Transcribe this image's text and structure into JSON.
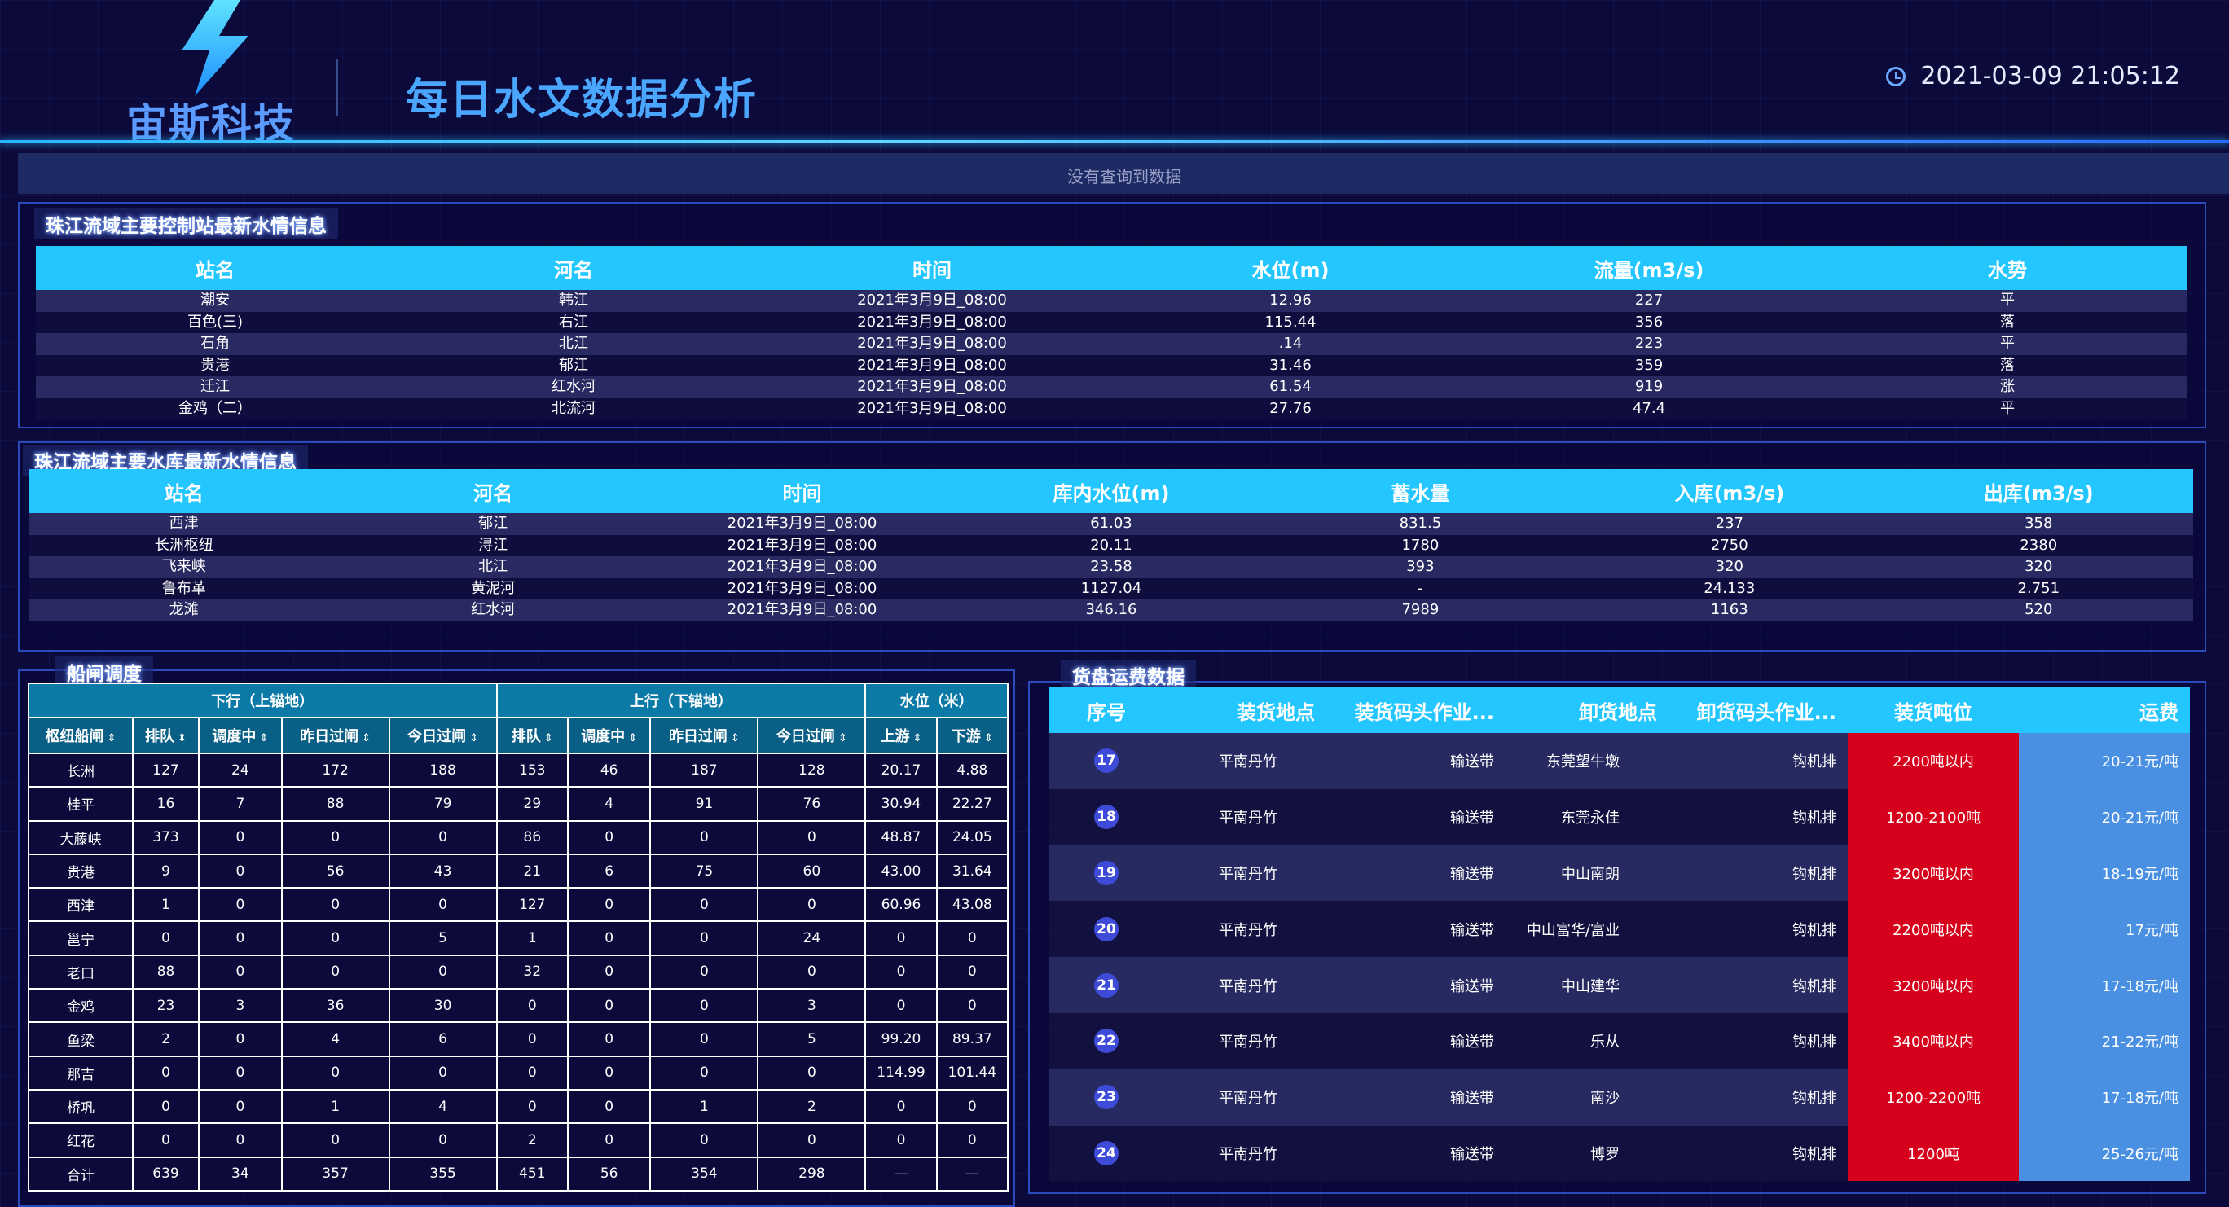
{
  "header": {
    "logo_text": "宙斯科技",
    "title": "每日水文数据分析",
    "datetime": "2021-03-09 21:05:12"
  },
  "notice": "没有查询到数据",
  "stations": {
    "label": "珠江流域主要控制站最新水情信息",
    "columns": [
      "站名",
      "河名",
      "时间",
      "水位(m)",
      "流量(m3/s)",
      "水势"
    ],
    "rows": [
      [
        "潮安",
        "韩江",
        "2021年3月9日_08:00",
        "12.96",
        "227",
        "平"
      ],
      [
        "百色(三)",
        "右江",
        "2021年3月9日_08:00",
        "115.44",
        "356",
        "落"
      ],
      [
        "石角",
        "北江",
        "2021年3月9日_08:00",
        ".14",
        "223",
        "平"
      ],
      [
        "贵港",
        "郁江",
        "2021年3月9日_08:00",
        "31.46",
        "359",
        "落"
      ],
      [
        "迁江",
        "红水河",
        "2021年3月9日_08:00",
        "61.54",
        "919",
        "涨"
      ],
      [
        "金鸡（二）",
        "北流河",
        "2021年3月9日_08:00",
        "27.76",
        "47.4",
        "平"
      ]
    ]
  },
  "reservoirs": {
    "label": "珠江流域主要水库最新水情信息",
    "columns": [
      "站名",
      "河名",
      "时间",
      "库内水位(m)",
      "蓄水量",
      "入库(m3/s)",
      "出库(m3/s)"
    ],
    "rows": [
      [
        "西津",
        "郁江",
        "2021年3月9日_08:00",
        "61.03",
        "831.5",
        "237",
        "358"
      ],
      [
        "长洲枢纽",
        "浔江",
        "2021年3月9日_08:00",
        "20.11",
        "1780",
        "2750",
        "2380"
      ],
      [
        "飞来峡",
        "北江",
        "2021年3月9日_08:00",
        "23.58",
        "393",
        "320",
        "320"
      ],
      [
        "鲁布革",
        "黄泥河",
        "2021年3月9日_08:00",
        "1127.04",
        "-",
        "24.133",
        "2.751"
      ],
      [
        "龙滩",
        "红水河",
        "2021年3月9日_08:00",
        "346.16",
        "7989",
        "1163",
        "520"
      ]
    ]
  },
  "locks": {
    "label": "船闸调度",
    "group_headers": [
      "下行（上锚地）",
      "上行（下锚地）",
      "水位（米）"
    ],
    "columns": [
      "枢纽船闸",
      "排队",
      "调度中",
      "昨日过闸",
      "今日过闸",
      "排队",
      "调度中",
      "昨日过闸",
      "今日过闸",
      "上游",
      "下游"
    ],
    "sort_icon": "⇕",
    "rows": [
      [
        "长洲",
        "127",
        "24",
        "172",
        "188",
        "153",
        "46",
        "187",
        "128",
        "20.17",
        "4.88"
      ],
      [
        "桂平",
        "16",
        "7",
        "88",
        "79",
        "29",
        "4",
        "91",
        "76",
        "30.94",
        "22.27"
      ],
      [
        "大藤峡",
        "373",
        "0",
        "0",
        "0",
        "86",
        "0",
        "0",
        "0",
        "48.87",
        "24.05"
      ],
      [
        "贵港",
        "9",
        "0",
        "56",
        "43",
        "21",
        "6",
        "75",
        "60",
        "43.00",
        "31.64"
      ],
      [
        "西津",
        "1",
        "0",
        "0",
        "0",
        "127",
        "0",
        "0",
        "0",
        "60.96",
        "43.08"
      ],
      [
        "邕宁",
        "0",
        "0",
        "0",
        "5",
        "1",
        "0",
        "0",
        "24",
        "0",
        "0"
      ],
      [
        "老口",
        "88",
        "0",
        "0",
        "0",
        "32",
        "0",
        "0",
        "0",
        "0",
        "0"
      ],
      [
        "金鸡",
        "23",
        "3",
        "36",
        "30",
        "0",
        "0",
        "0",
        "3",
        "0",
        "0"
      ],
      [
        "鱼梁",
        "2",
        "0",
        "4",
        "6",
        "0",
        "0",
        "0",
        "5",
        "99.20",
        "89.37"
      ],
      [
        "那吉",
        "0",
        "0",
        "0",
        "0",
        "0",
        "0",
        "0",
        "0",
        "114.99",
        "101.44"
      ],
      [
        "桥巩",
        "0",
        "0",
        "1",
        "4",
        "0",
        "0",
        "1",
        "2",
        "0",
        "0"
      ],
      [
        "红花",
        "0",
        "0",
        "0",
        "0",
        "2",
        "0",
        "0",
        "0",
        "0",
        "0"
      ],
      [
        "合计",
        "639",
        "34",
        "357",
        "355",
        "451",
        "56",
        "354",
        "298",
        "—",
        "—"
      ]
    ]
  },
  "cargo": {
    "label": "货盘运费数据",
    "columns": [
      "序号",
      "装货地点",
      "装货码头作业...",
      "卸货地点",
      "卸货码头作业...",
      "装货吨位",
      "运费"
    ],
    "colors": {
      "ton_bg": "#d6001c",
      "fee_bg": "#4a90e2"
    },
    "rows": [
      [
        "17",
        "平南丹竹",
        "输送带",
        "东莞望牛墩",
        "钩机排",
        "2200吨以内",
        "20-21元/吨"
      ],
      [
        "18",
        "平南丹竹",
        "输送带",
        "东莞永佳",
        "钩机排",
        "1200-2100吨",
        "20-21元/吨"
      ],
      [
        "19",
        "平南丹竹",
        "输送带",
        "中山南朗",
        "钩机排",
        "3200吨以内",
        "18-19元/吨"
      ],
      [
        "20",
        "平南丹竹",
        "输送带",
        "中山富华/富业",
        "钩机排",
        "2200吨以内",
        "17元/吨"
      ],
      [
        "21",
        "平南丹竹",
        "输送带",
        "中山建华",
        "钩机排",
        "3200吨以内",
        "17-18元/吨"
      ],
      [
        "22",
        "平南丹竹",
        "输送带",
        "乐从",
        "钩机排",
        "3400吨以内",
        "21-22元/吨"
      ],
      [
        "23",
        "平南丹竹",
        "输送带",
        "南沙",
        "钩机排",
        "1200-2200吨",
        "17-18元/吨"
      ],
      [
        "24",
        "平南丹竹",
        "输送带",
        "博罗",
        "钩机排",
        "1200吨",
        "25-26元/吨"
      ]
    ]
  }
}
